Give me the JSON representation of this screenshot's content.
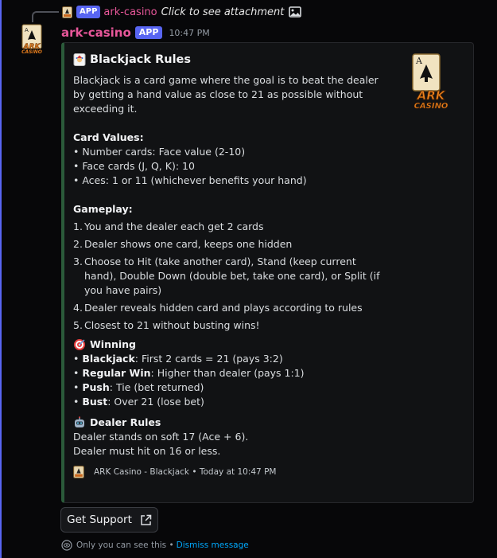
{
  "reply": {
    "app_tag": "APP",
    "author": "ark-casino",
    "text": "Click to see attachment"
  },
  "message": {
    "author": "ark-casino",
    "app_tag": "APP",
    "time": "10:47 PM"
  },
  "embed": {
    "title": "Blackjack Rules",
    "intro": "Blackjack is a card game where the goal is to beat the dealer by getting a hand value as close to 21 as possible without exceeding it.",
    "card_values": {
      "title": "Card Values:",
      "items": [
        "• Number cards: Face value (2-10)",
        "• Face cards (J, Q, K): 10",
        "• Aces: 1 or 11 (whichever benefits your hand)"
      ]
    },
    "gameplay": {
      "title": "Gameplay:",
      "steps": [
        {
          "num": "1.",
          "text": "You and the dealer each get 2 cards"
        },
        {
          "num": "2.",
          "text": "Dealer shows one card, keeps one hidden"
        },
        {
          "num": "3.",
          "text": "Choose to Hit (take another card), Stand (keep current hand), Double Down (double bet, take one card), or Split (if you have pairs)"
        },
        {
          "num": "4.",
          "text": "Dealer reveals hidden card and plays according to rules"
        },
        {
          "num": "5.",
          "text": "Closest to 21 without busting wins!"
        }
      ]
    },
    "winning": {
      "title": "Winning",
      "items": [
        {
          "label": "Blackjack",
          "text": ": First 2 cards = 21 (pays 3:2)"
        },
        {
          "label": "Regular Win",
          "text": ": Higher than dealer (pays 1:1)"
        },
        {
          "label": "Push",
          "text": ": Tie (bet returned)"
        },
        {
          "label": "Bust",
          "text": ": Over 21 (lose bet)"
        }
      ]
    },
    "dealer_rules": {
      "title": "Dealer Rules",
      "lines": [
        "Dealer stands on soft 17 (Ace + 6).",
        "Dealer must hit on 16 or less."
      ]
    },
    "footer": "ARK Casino - Blackjack • Today at 10:47 PM",
    "thumbnail_text": {
      "card": "A",
      "logo_line1": "ARK",
      "logo_line2": "CASINO"
    }
  },
  "button": {
    "label": "Get Support"
  },
  "ephemeral": {
    "notice": "Only you can see this •",
    "dismiss": "Dismiss message"
  },
  "icons": {
    "reply_attachment": "image-icon",
    "button_icon": "external-link-icon",
    "ephemeral_icon": "eye-icon"
  },
  "colors": {
    "accent": "#5865f2",
    "author": "#e8579a",
    "embed_bar": "#2b5a3a",
    "link": "#00a8fc"
  }
}
